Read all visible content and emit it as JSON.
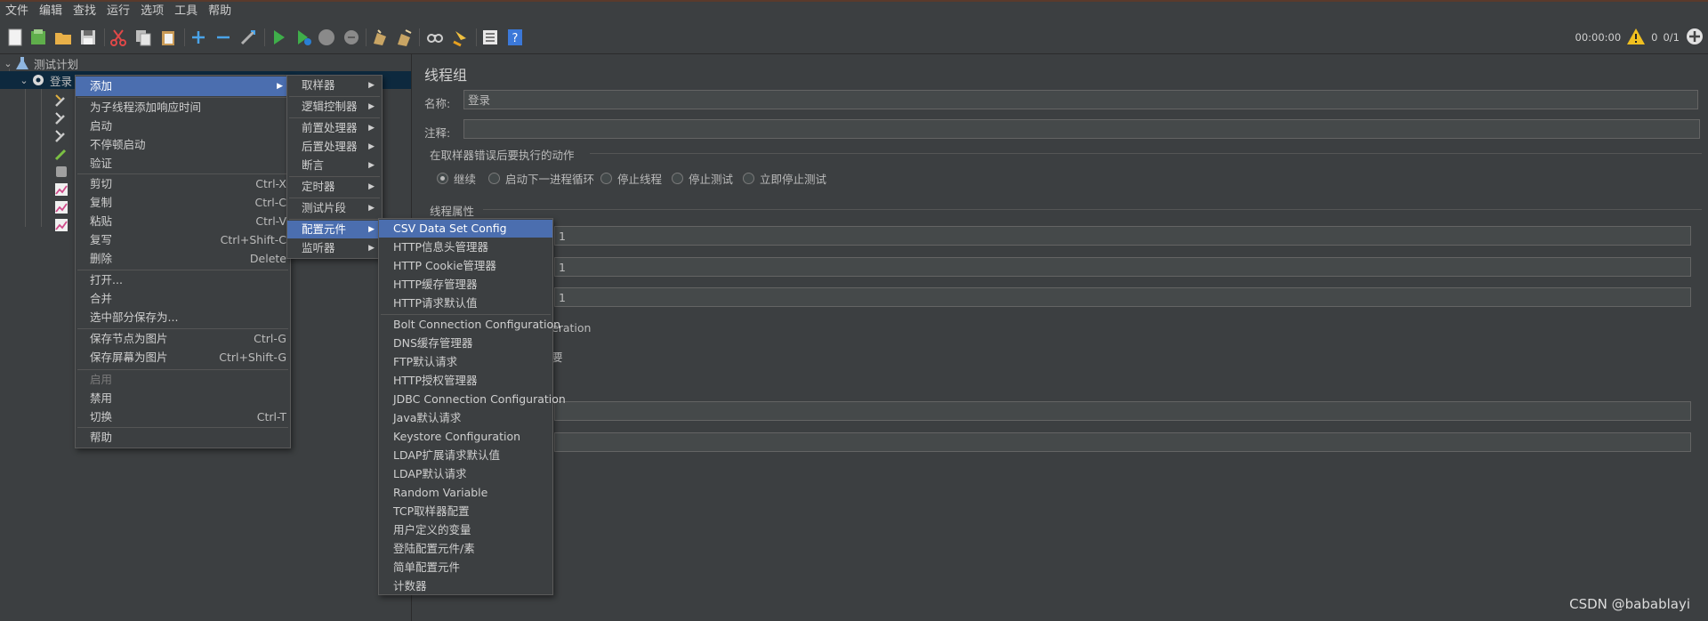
{
  "menubar": [
    "文件",
    "编辑",
    "查找",
    "运行",
    "选项",
    "工具",
    "帮助"
  ],
  "status": {
    "timer": "00:00:00",
    "warnings": "0",
    "threads": "0/1"
  },
  "tree": {
    "root": "测试计划",
    "group": "登录"
  },
  "context_menu": {
    "items": [
      {
        "label": "添加",
        "submenu": true,
        "highlighted": true
      },
      {
        "label": "为子线程添加响应时间"
      },
      {
        "label": "启动"
      },
      {
        "label": "不停顿启动"
      },
      {
        "label": "验证"
      },
      {
        "label": "剪切",
        "shortcut": "Ctrl-X"
      },
      {
        "label": "复制",
        "shortcut": "Ctrl-C"
      },
      {
        "label": "粘贴",
        "shortcut": "Ctrl-V"
      },
      {
        "label": "复写",
        "shortcut": "Ctrl+Shift-C"
      },
      {
        "label": "删除",
        "shortcut": "Delete"
      },
      {
        "label": "打开..."
      },
      {
        "label": "合并"
      },
      {
        "label": "选中部分保存为..."
      },
      {
        "label": "保存节点为图片",
        "shortcut": "Ctrl-G"
      },
      {
        "label": "保存屏幕为图片",
        "shortcut": "Ctrl+Shift-G"
      },
      {
        "label": "启用",
        "disabled": true
      },
      {
        "label": "禁用"
      },
      {
        "label": "切换",
        "shortcut": "Ctrl-T"
      },
      {
        "label": "帮助"
      }
    ]
  },
  "add_menu": {
    "items": [
      {
        "label": "取样器"
      },
      {
        "label": "逻辑控制器"
      },
      {
        "label": "前置处理器"
      },
      {
        "label": "后置处理器"
      },
      {
        "label": "断言"
      },
      {
        "label": "定时器"
      },
      {
        "label": "测试片段"
      },
      {
        "label": "配置元件",
        "highlighted": true
      },
      {
        "label": "监听器"
      }
    ]
  },
  "config_menu": {
    "items": [
      {
        "label": "CSV Data Set Config",
        "highlighted": true
      },
      {
        "label": "HTTP信息头管理器"
      },
      {
        "label": "HTTP Cookie管理器"
      },
      {
        "label": "HTTP缓存管理器"
      },
      {
        "label": "HTTP请求默认值"
      },
      {
        "label": "Bolt Connection Configuration"
      },
      {
        "label": "DNS缓存管理器"
      },
      {
        "label": "FTP默认请求"
      },
      {
        "label": "HTTP授权管理器"
      },
      {
        "label": "JDBC Connection Configuration"
      },
      {
        "label": "Java默认请求"
      },
      {
        "label": "Keystore Configuration"
      },
      {
        "label": "LDAP扩展请求默认值"
      },
      {
        "label": "LDAP默认请求"
      },
      {
        "label": "Random Variable"
      },
      {
        "label": "TCP取样器配置"
      },
      {
        "label": "用户定义的变量"
      },
      {
        "label": "登陆配置元件/素"
      },
      {
        "label": "简单配置元件"
      },
      {
        "label": "计数器"
      }
    ]
  },
  "panel": {
    "title": "线程组",
    "name_label": "名称:",
    "name_value": "登录",
    "comment_label": "注释:",
    "comment_value": "",
    "error_group": "在取样器错误后要执行的动作",
    "radios": [
      {
        "label": "继续",
        "checked": true
      },
      {
        "label": "启动下一进程循环"
      },
      {
        "label": "停止线程"
      },
      {
        "label": "停止测试"
      },
      {
        "label": "立即停止测试"
      }
    ],
    "thread_props": "线程属性",
    "values": [
      "1",
      "1",
      "1"
    ],
    "partial_iteration": "eration",
    "partial_need": "要"
  },
  "watermark": "CSDN @babablayi"
}
